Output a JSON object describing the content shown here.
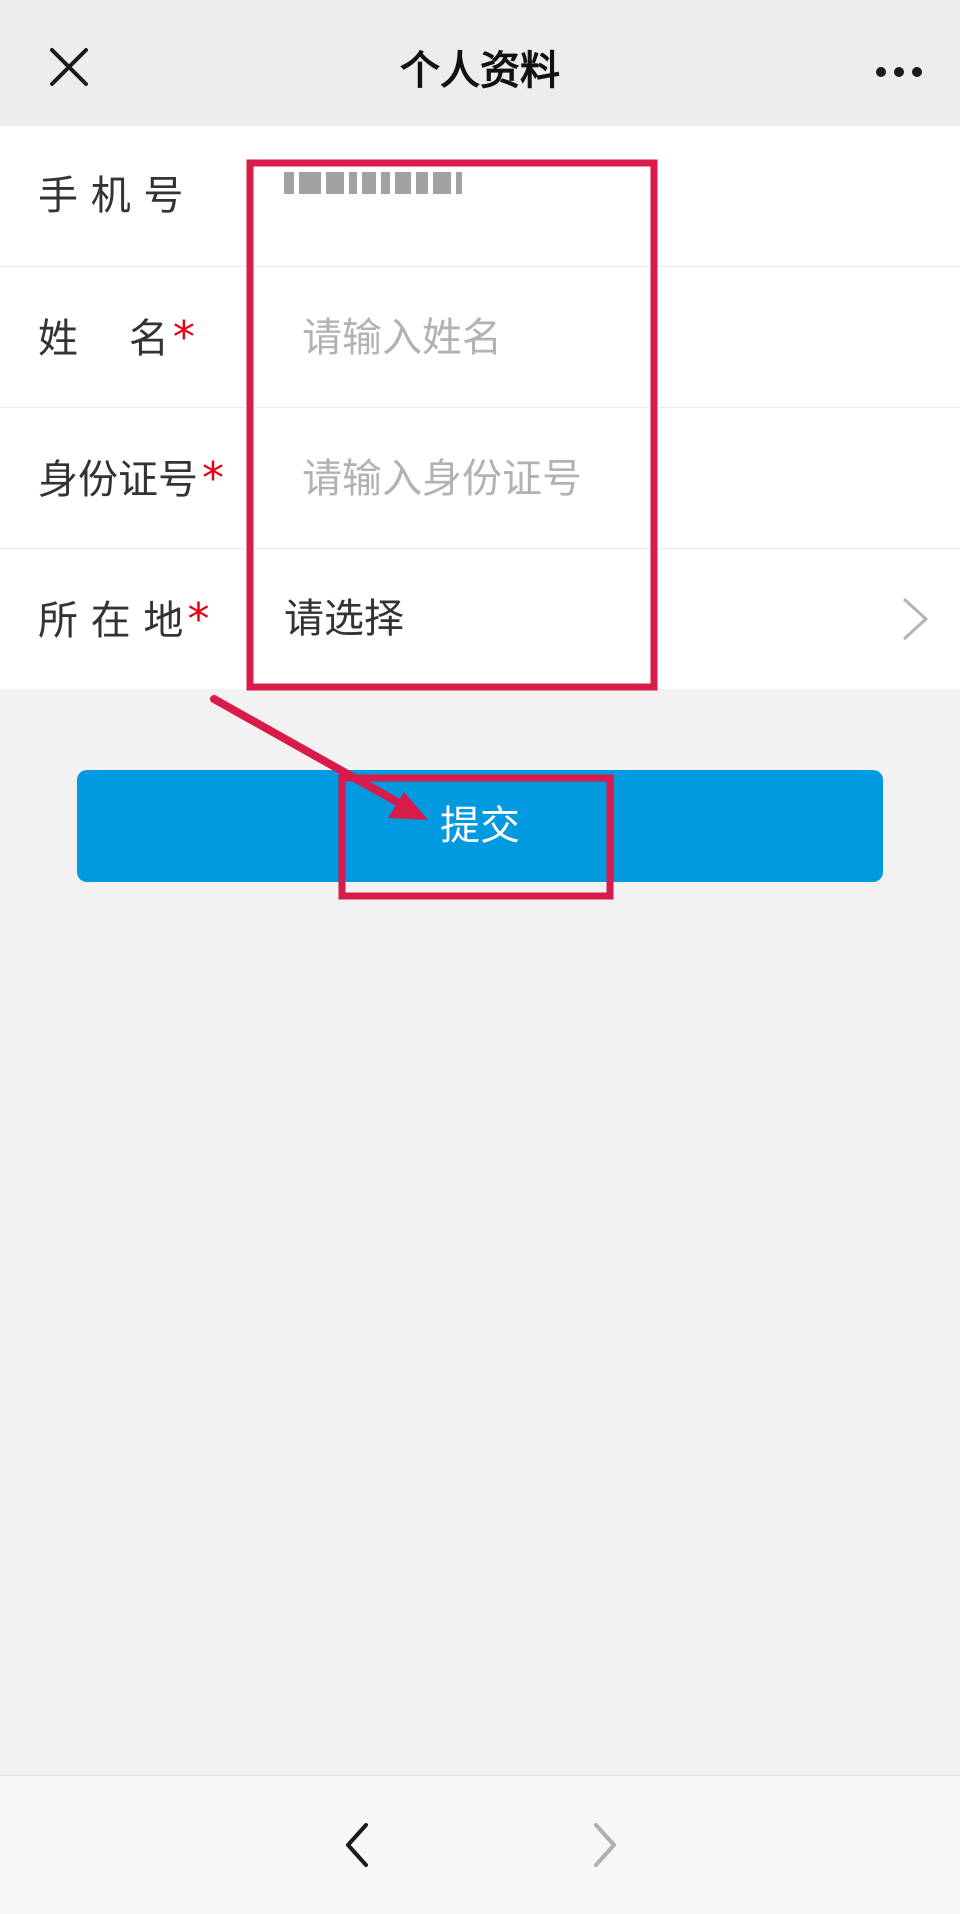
{
  "navbar": {
    "title": "个人资料",
    "close_icon": "close-icon",
    "more_icon": "more-dots-icon"
  },
  "form": {
    "phone": {
      "label": "手 机 号",
      "value_masked": true
    },
    "name": {
      "label": "姓    名",
      "required_mark": "*",
      "placeholder": "请输入姓名"
    },
    "id_number": {
      "label": "身份证号",
      "required_mark": "*",
      "placeholder": "请输入身份证号"
    },
    "location": {
      "label": "所 在 地",
      "required_mark": "*",
      "value": "请选择",
      "chevron_icon": "chevron-right-icon"
    }
  },
  "submit": {
    "label": "提交"
  },
  "bottom_nav": {
    "back_icon": "chevron-left-icon",
    "forward_icon": "chevron-right-icon"
  },
  "colors": {
    "primary": "#0199e0",
    "required": "#e60012",
    "annotation": "#d81b4a",
    "navbar_bg": "#ededed",
    "page_bg": "#f2f2f2"
  }
}
